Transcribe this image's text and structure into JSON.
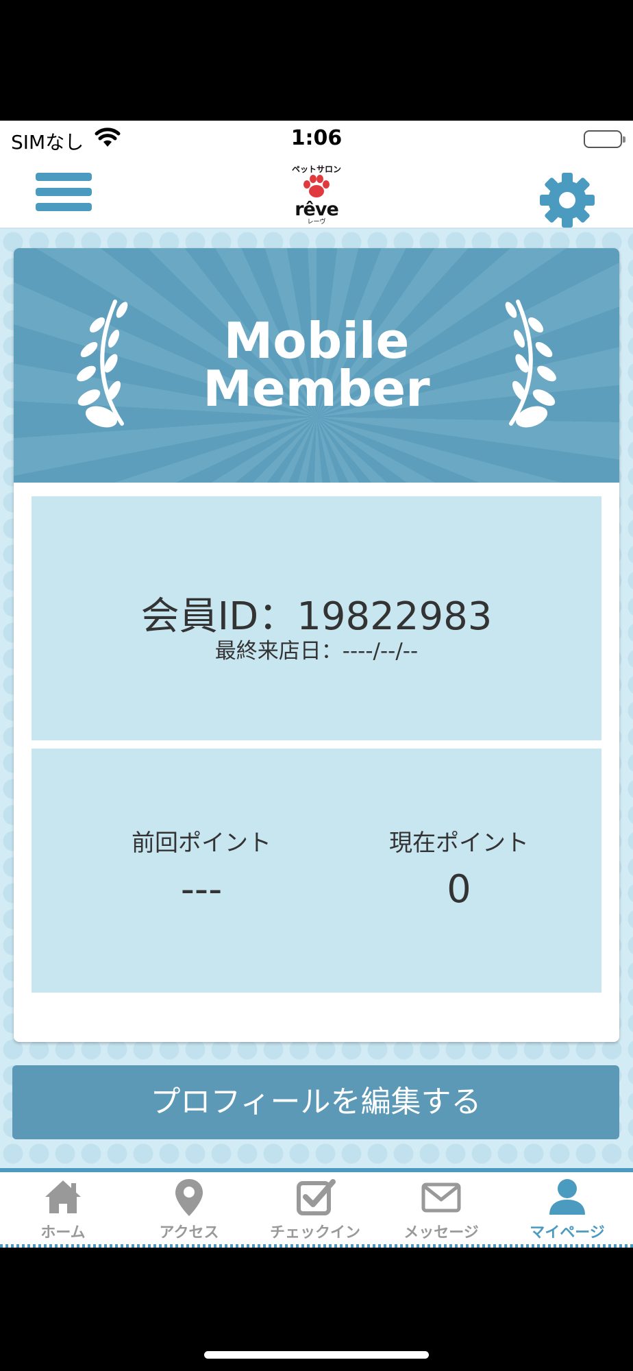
{
  "status_bar": {
    "carrier": "SIMなし",
    "time": "1:06"
  },
  "header": {
    "logo": {
      "top_text": "ペットサロン",
      "main_text": "rêve",
      "sub_text": "レーヴ"
    }
  },
  "banner": {
    "title_line1": "Mobile",
    "title_line2": "Member"
  },
  "member": {
    "id_text": "会員ID：19822983",
    "last_visit_text": "最終来店日：----/--/--"
  },
  "points": {
    "previous_label": "前回ポイント",
    "previous_value": "---",
    "current_label": "現在ポイント",
    "current_value": "0"
  },
  "edit_profile_label": "プロフィールを編集する",
  "tabs": [
    {
      "label": "ホーム",
      "icon": "home-icon"
    },
    {
      "label": "アクセス",
      "icon": "map-pin-icon"
    },
    {
      "label": "チェックイン",
      "icon": "checkbox-icon"
    },
    {
      "label": "メッセージ",
      "icon": "envelope-icon"
    },
    {
      "label": "マイページ",
      "icon": "user-icon",
      "active": true
    }
  ],
  "colors": {
    "accent": "#4a9bbf",
    "banner": "#5d9ebc",
    "panel": "#c8e6f0",
    "button": "#5b99b7",
    "inactive_tab": "#999999"
  }
}
